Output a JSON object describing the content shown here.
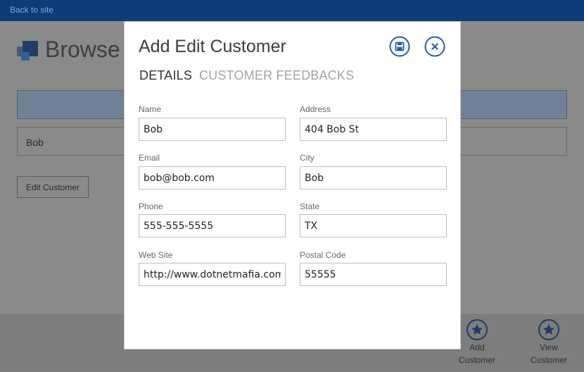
{
  "topbar": {
    "back_label": "Back to site",
    "color": "#0d3c78"
  },
  "page": {
    "title": "Browse",
    "grid": {
      "rows": [
        {
          "name": "Bob"
        }
      ]
    },
    "edit_button": "Edit Customer"
  },
  "commands": [
    {
      "label_line1": "Add",
      "label_line2": "Customer",
      "icon": "star-icon"
    },
    {
      "label_line1": "View",
      "label_line2": "Customer",
      "icon": "star-icon"
    }
  ],
  "modal": {
    "title": "Add Edit Customer",
    "accent": "#1e5fae",
    "save_icon": "floppy-disk-icon",
    "close_icon": "close-icon",
    "tabs": [
      {
        "label": "DETAILS",
        "active": true
      },
      {
        "label": "CUSTOMER FEEDBACKS",
        "active": false
      }
    ],
    "fields": {
      "name": {
        "label": "Name",
        "value": "Bob"
      },
      "email": {
        "label": "Email",
        "value": "bob@bob.com"
      },
      "phone": {
        "label": "Phone",
        "value": "555-555-5555"
      },
      "website": {
        "label": "Web Site",
        "value": "http://www.dotnetmafia.com"
      },
      "address": {
        "label": "Address",
        "value": "404 Bob St"
      },
      "city": {
        "label": "City",
        "value": "Bob"
      },
      "state": {
        "label": "State",
        "value": "TX"
      },
      "postal": {
        "label": "Postal Code",
        "value": "55555"
      }
    }
  }
}
